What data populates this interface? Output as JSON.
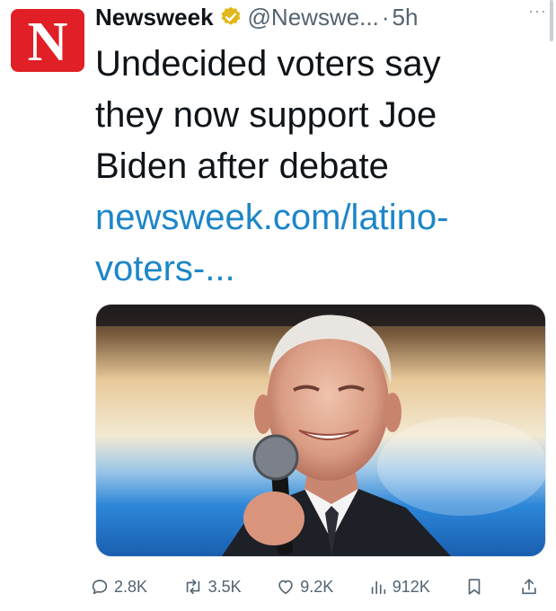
{
  "tweet": {
    "avatar_letter": "N",
    "account_name": "Newsweek",
    "handle": "@Newswe...",
    "separator": "·",
    "time": "5h",
    "more_label": "···",
    "text_lines": [
      "Undecided voters say",
      "they now support Joe",
      "Biden after debate"
    ],
    "link_lines": [
      "newsweek.com/latino-",
      "voters-..."
    ],
    "media_icon": "photo-of-man-speaking-into-microphone"
  },
  "actions": {
    "replies": "2.8K",
    "reposts": "3.5K",
    "likes": "9.2K",
    "views": "912K"
  },
  "colors": {
    "brand_red": "#e01f26",
    "link_blue": "#1d86c8",
    "verified_gold": "#e2b719",
    "muted_gray": "#536471"
  }
}
